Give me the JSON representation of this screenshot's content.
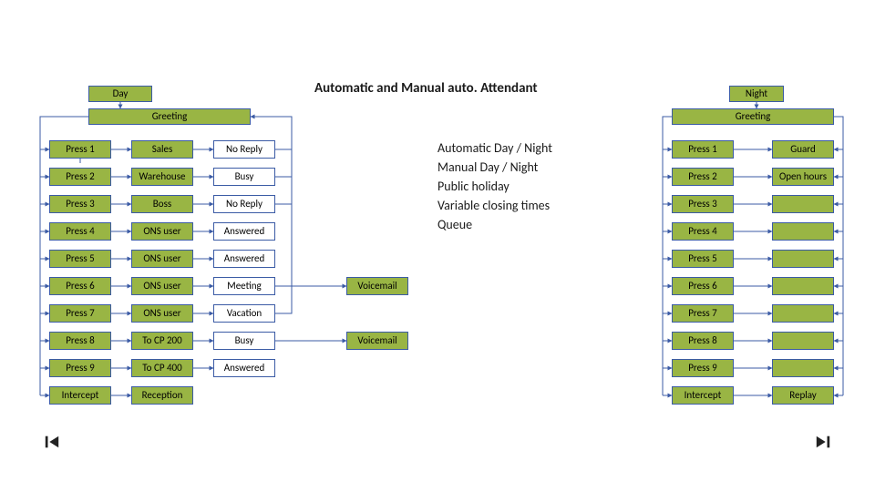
{
  "title": "Automatic and Manual auto. Attendant",
  "day": {
    "header": "Day",
    "greeting": "Greeting",
    "rows": [
      {
        "press": "Press 1",
        "dest": "Sales",
        "status": "No Reply"
      },
      {
        "press": "Press 2",
        "dest": "Warehouse",
        "status": "Busy"
      },
      {
        "press": "Press 3",
        "dest": "Boss",
        "status": "No Reply"
      },
      {
        "press": "Press 4",
        "dest": "ONS user",
        "status": "Answered"
      },
      {
        "press": "Press 5",
        "dest": "ONS user",
        "status": "Answered"
      },
      {
        "press": "Press 6",
        "dest": "ONS user",
        "status": "Meeting"
      },
      {
        "press": "Press 7",
        "dest": "ONS user",
        "status": "Vacation"
      },
      {
        "press": "Press 8",
        "dest": "To  CP 200",
        "status": "Busy"
      },
      {
        "press": "Press 9",
        "dest": "To  CP 400",
        "status": "Answered"
      },
      {
        "press": "Intercept",
        "dest": "Reception",
        "status": ""
      }
    ],
    "voicemail6": "Voicemail",
    "voicemail8": "Voicemail"
  },
  "night": {
    "header": "Night",
    "greeting": "Greeting",
    "rows": [
      {
        "press": "Press 1",
        "dest": "Guard"
      },
      {
        "press": "Press 2",
        "dest": "Open hours"
      },
      {
        "press": "Press 3",
        "dest": ""
      },
      {
        "press": "Press 4",
        "dest": ""
      },
      {
        "press": "Press 5",
        "dest": ""
      },
      {
        "press": "Press 6",
        "dest": ""
      },
      {
        "press": "Press 7",
        "dest": ""
      },
      {
        "press": "Press 8",
        "dest": ""
      },
      {
        "press": "Press 9",
        "dest": ""
      },
      {
        "press": "Intercept",
        "dest": "Replay"
      }
    ]
  },
  "center": {
    "line1": "Automatic Day / Night",
    "line2": "Manual Day / Night",
    "line3": "Public holiday",
    "line4": "Variable closing times",
    "line5": "Queue"
  }
}
